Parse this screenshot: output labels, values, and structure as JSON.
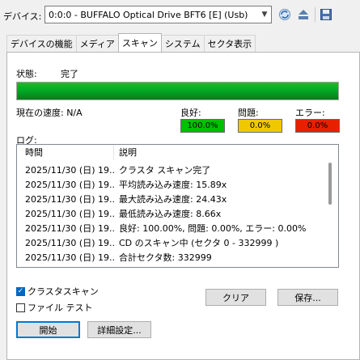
{
  "device": {
    "label": "デバイス:",
    "selected": "0:0:0 - BUFFALO Optical Drive BFT6 [E] (Usb)",
    "refresh_icon": "refresh-icon",
    "eject_icon": "eject-icon",
    "save_icon": "save-icon"
  },
  "tabs": [
    {
      "label": "デバイスの機能"
    },
    {
      "label": "メディア"
    },
    {
      "label": "スキャン"
    },
    {
      "label": "システム"
    },
    {
      "label": "セクタ表示"
    }
  ],
  "active_tab": "スキャン",
  "scan": {
    "status_label": "状態:",
    "status_value": "完了",
    "progress": 1.0,
    "speed_label": "現在の速度: N/A",
    "meters": {
      "good": {
        "label": "良好:",
        "value": "100.0%",
        "color": "#00c000"
      },
      "problem": {
        "label": "問題:",
        "value": "0.0%",
        "color": "#f0c800"
      },
      "error": {
        "label": "エラー:",
        "value": "0.0%",
        "color": "#e82000"
      }
    },
    "log_label": "ログ:",
    "log_columns": [
      "時間",
      "説明"
    ],
    "log_rows": [
      {
        "time": "2025/11/30 (日) 19...",
        "desc": "クラスタ スキャン完了"
      },
      {
        "time": "2025/11/30 (日) 19...",
        "desc": "平均読み込み速度: 15.89x"
      },
      {
        "time": "2025/11/30 (日) 19...",
        "desc": "最大読み込み速度: 24.43x"
      },
      {
        "time": "2025/11/30 (日) 19...",
        "desc": "最低読み込み速度: 8.66x"
      },
      {
        "time": "2025/11/30 (日) 19...",
        "desc": "良好: 100.00%, 問題: 0.00%, エラー: 0.00%"
      },
      {
        "time": "2025/11/30 (日) 19...",
        "desc": "CD のスキャン中 (セクタ 0 - 332999 )"
      },
      {
        "time": "2025/11/30 (日) 19...",
        "desc": "合計セクタ数: 332999"
      }
    ],
    "cluster_scan": {
      "label": "クラスタスキャン",
      "checked": true
    },
    "file_test": {
      "label": "ファイル テスト",
      "checked": false
    },
    "buttons": {
      "clear": "クリア",
      "save": "保存...",
      "start": "開始",
      "advanced": "詳細設定..."
    }
  }
}
